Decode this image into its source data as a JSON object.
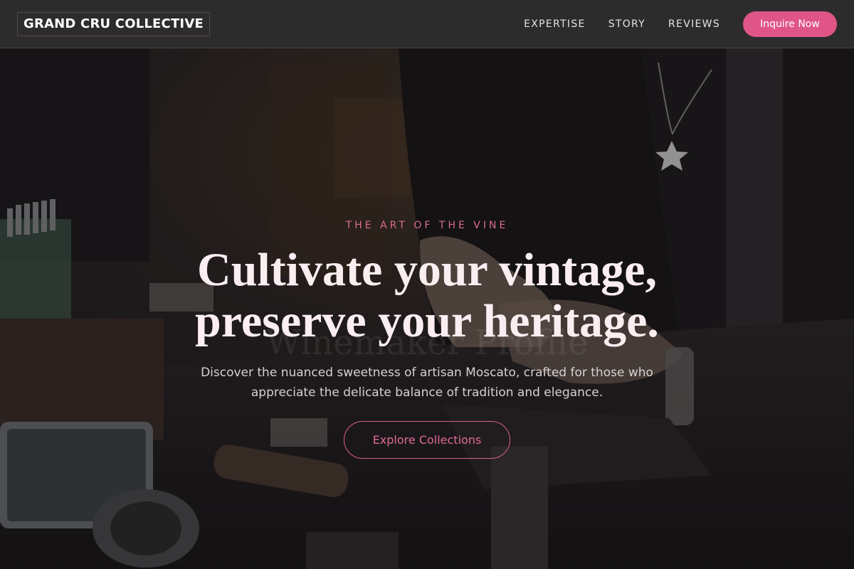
{
  "nav": {
    "brand": "GRAND CRU COLLECTIVE",
    "links": [
      "EXPERTISE",
      "STORY",
      "REVIEWS"
    ],
    "cta": "Inquire Now"
  },
  "hero": {
    "eyebrow": "THE ART OF THE VINE",
    "headline_line1": "Cultivate your vintage,",
    "headline_line2": "preserve your heritage.",
    "watermark": "Winemaker Profile",
    "subtext": "Discover the nuanced sweetness of artisan Moscato, crafted for those who appreciate the delicate balance of tradition and elegance.",
    "cta": "Explore Collections"
  },
  "colors": {
    "accent": "#e05587",
    "nav_bg": "#2d2c2c",
    "headline": "#fbeef1"
  }
}
